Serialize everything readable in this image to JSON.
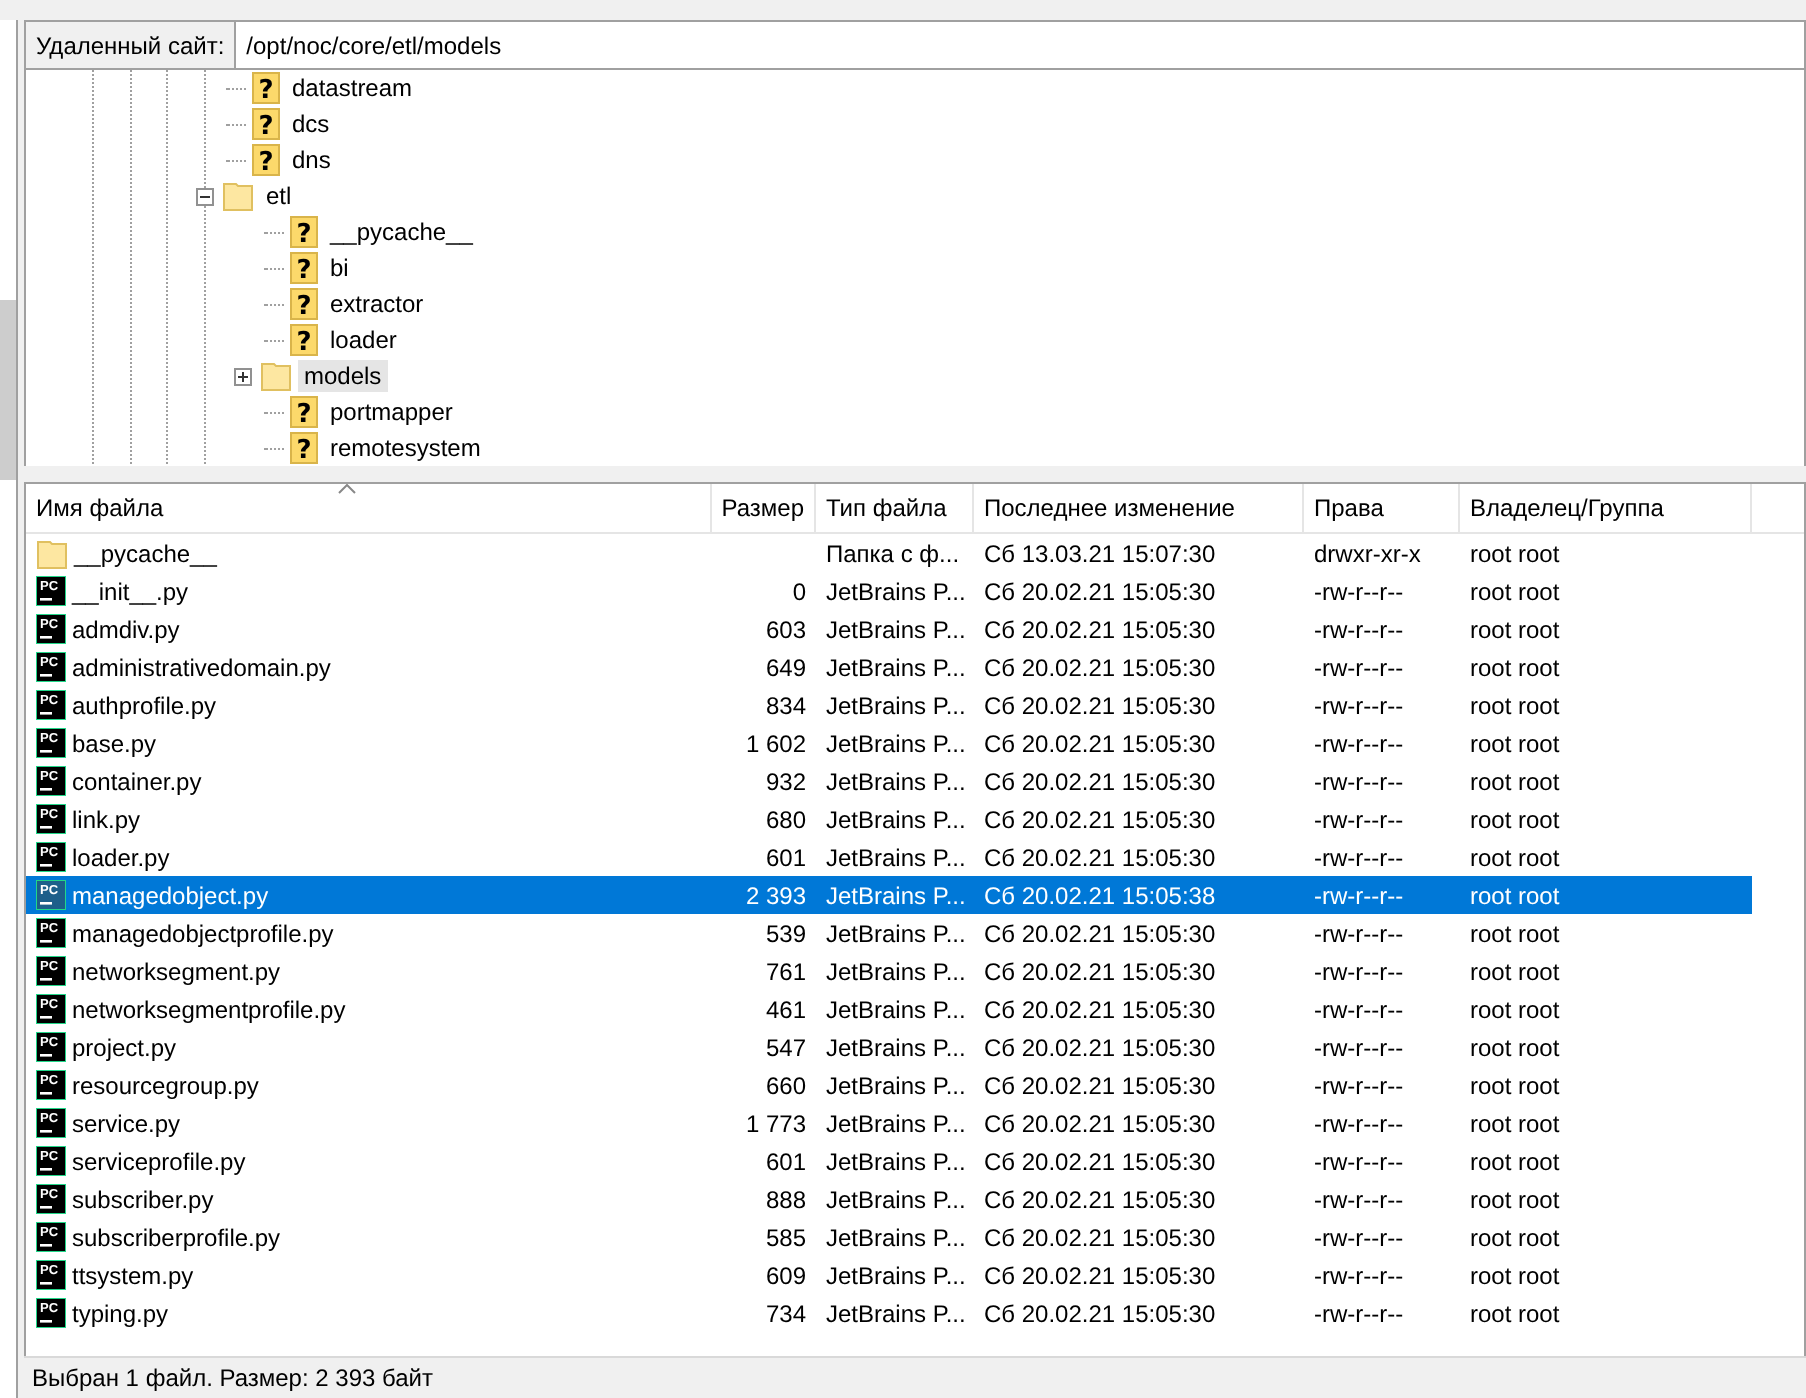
{
  "remote_site": {
    "label": "Удаленный сайт:",
    "path": "/opt/noc/core/etl/models"
  },
  "tree": [
    {
      "name": "datastream",
      "kind": "unknown",
      "icon_text": "?",
      "selected": false
    },
    {
      "name": "dcs",
      "kind": "unknown",
      "icon_text": "?",
      "selected": false
    },
    {
      "name": "dns",
      "kind": "unknown",
      "icon_text": "?",
      "selected": false
    },
    {
      "name": "etl",
      "kind": "folder",
      "selected": false,
      "expanded": true,
      "children": [
        {
          "name": "__pycache__",
          "kind": "unknown",
          "icon_text": "?",
          "selected": false
        },
        {
          "name": "bi",
          "kind": "unknown",
          "icon_text": "?",
          "selected": false
        },
        {
          "name": "extractor",
          "kind": "unknown",
          "icon_text": "?",
          "selected": false
        },
        {
          "name": "loader",
          "kind": "unknown",
          "icon_text": "?",
          "selected": false
        },
        {
          "name": "models",
          "kind": "folder",
          "selected": true,
          "expanded": false
        },
        {
          "name": "portmapper",
          "kind": "unknown",
          "icon_text": "?",
          "selected": false
        },
        {
          "name": "remotesystem",
          "kind": "unknown",
          "icon_text": "?",
          "selected": false
        }
      ]
    }
  ],
  "table": {
    "columns": [
      "Имя файла",
      "Размер",
      "Тип файла",
      "Последнее изменение",
      "Права",
      "Владелец/Группа"
    ],
    "rows": [
      {
        "kind": "folder",
        "name": "__pycache__",
        "type": "Папка с ф...",
        "modified": "Сб 13.03.21 15:07:30",
        "perms": "drwxr-xr-x",
        "owner": "root root",
        "selected": false
      },
      {
        "kind": "pycharm",
        "icon_text": "PC",
        "name": "__init__.py",
        "size": "0",
        "type": "JetBrains P...",
        "modified": "Сб 20.02.21 15:05:30",
        "perms": "-rw-r--r--",
        "owner": "root root",
        "selected": false
      },
      {
        "kind": "pycharm",
        "icon_text": "PC",
        "name": "admdiv.py",
        "size": "603",
        "type": "JetBrains P...",
        "modified": "Сб 20.02.21 15:05:30",
        "perms": "-rw-r--r--",
        "owner": "root root",
        "selected": false
      },
      {
        "kind": "pycharm",
        "icon_text": "PC",
        "name": "administrativedomain.py",
        "size": "649",
        "type": "JetBrains P...",
        "modified": "Сб 20.02.21 15:05:30",
        "perms": "-rw-r--r--",
        "owner": "root root",
        "selected": false
      },
      {
        "kind": "pycharm",
        "icon_text": "PC",
        "name": "authprofile.py",
        "size": "834",
        "type": "JetBrains P...",
        "modified": "Сб 20.02.21 15:05:30",
        "perms": "-rw-r--r--",
        "owner": "root root",
        "selected": false
      },
      {
        "kind": "pycharm",
        "icon_text": "PC",
        "name": "base.py",
        "size": "1 602",
        "type": "JetBrains P...",
        "modified": "Сб 20.02.21 15:05:30",
        "perms": "-rw-r--r--",
        "owner": "root root",
        "selected": false
      },
      {
        "kind": "pycharm",
        "icon_text": "PC",
        "name": "container.py",
        "size": "932",
        "type": "JetBrains P...",
        "modified": "Сб 20.02.21 15:05:30",
        "perms": "-rw-r--r--",
        "owner": "root root",
        "selected": false
      },
      {
        "kind": "pycharm",
        "icon_text": "PC",
        "name": "link.py",
        "size": "680",
        "type": "JetBrains P...",
        "modified": "Сб 20.02.21 15:05:30",
        "perms": "-rw-r--r--",
        "owner": "root root",
        "selected": false
      },
      {
        "kind": "pycharm",
        "icon_text": "PC",
        "name": "loader.py",
        "size": "601",
        "type": "JetBrains P...",
        "modified": "Сб 20.02.21 15:05:30",
        "perms": "-rw-r--r--",
        "owner": "root root",
        "selected": false
      },
      {
        "kind": "pycharm",
        "icon_text": "PC",
        "name": "managedobject.py",
        "size": "2 393",
        "type": "JetBrains P...",
        "modified": "Сб 20.02.21 15:05:38",
        "perms": "-rw-r--r--",
        "owner": "root root",
        "selected": true
      },
      {
        "kind": "pycharm",
        "icon_text": "PC",
        "name": "managedobjectprofile.py",
        "size": "539",
        "type": "JetBrains P...",
        "modified": "Сб 20.02.21 15:05:30",
        "perms": "-rw-r--r--",
        "owner": "root root",
        "selected": false
      },
      {
        "kind": "pycharm",
        "icon_text": "PC",
        "name": "networksegment.py",
        "size": "761",
        "type": "JetBrains P...",
        "modified": "Сб 20.02.21 15:05:30",
        "perms": "-rw-r--r--",
        "owner": "root root",
        "selected": false
      },
      {
        "kind": "pycharm",
        "icon_text": "PC",
        "name": "networksegmentprofile.py",
        "size": "461",
        "type": "JetBrains P...",
        "modified": "Сб 20.02.21 15:05:30",
        "perms": "-rw-r--r--",
        "owner": "root root",
        "selected": false
      },
      {
        "kind": "pycharm",
        "icon_text": "PC",
        "name": "project.py",
        "size": "547",
        "type": "JetBrains P...",
        "modified": "Сб 20.02.21 15:05:30",
        "perms": "-rw-r--r--",
        "owner": "root root",
        "selected": false
      },
      {
        "kind": "pycharm",
        "icon_text": "PC",
        "name": "resourcegroup.py",
        "size": "660",
        "type": "JetBrains P...",
        "modified": "Сб 20.02.21 15:05:30",
        "perms": "-rw-r--r--",
        "owner": "root root",
        "selected": false
      },
      {
        "kind": "pycharm",
        "icon_text": "PC",
        "name": "service.py",
        "size": "1 773",
        "type": "JetBrains P...",
        "modified": "Сб 20.02.21 15:05:30",
        "perms": "-rw-r--r--",
        "owner": "root root",
        "selected": false
      },
      {
        "kind": "pycharm",
        "icon_text": "PC",
        "name": "serviceprofile.py",
        "size": "601",
        "type": "JetBrains P...",
        "modified": "Сб 20.02.21 15:05:30",
        "perms": "-rw-r--r--",
        "owner": "root root",
        "selected": false
      },
      {
        "kind": "pycharm",
        "icon_text": "PC",
        "name": "subscriber.py",
        "size": "888",
        "type": "JetBrains P...",
        "modified": "Сб 20.02.21 15:05:30",
        "perms": "-rw-r--r--",
        "owner": "root root",
        "selected": false
      },
      {
        "kind": "pycharm",
        "icon_text": "PC",
        "name": "subscriberprofile.py",
        "size": "585",
        "type": "JetBrains P...",
        "modified": "Сб 20.02.21 15:05:30",
        "perms": "-rw-r--r--",
        "owner": "root root",
        "selected": false
      },
      {
        "kind": "pycharm",
        "icon_text": "PC",
        "name": "ttsystem.py",
        "size": "609",
        "type": "JetBrains P...",
        "modified": "Сб 20.02.21 15:05:30",
        "perms": "-rw-r--r--",
        "owner": "root root",
        "selected": false
      },
      {
        "kind": "pycharm",
        "icon_text": "PC",
        "name": "typing.py",
        "size": "734",
        "type": "JetBrains P...",
        "modified": "Сб 20.02.21 15:05:30",
        "perms": "-rw-r--r--",
        "owner": "root root",
        "selected": false
      }
    ]
  },
  "status_bar": "Выбран 1 файл. Размер: 2 393 байт"
}
